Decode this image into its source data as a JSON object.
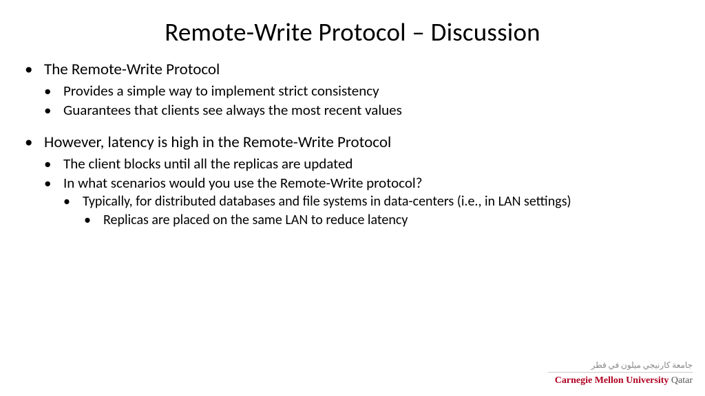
{
  "title": "Remote-Write Protocol – Discussion",
  "bullets": {
    "b1": "The Remote-Write Protocol",
    "b1a": "Provides a simple way to implement strict consistency",
    "b1b": "Guarantees that clients see always the most recent values",
    "b2": "However, latency is high in the Remote-Write Protocol",
    "b2a": "The client blocks until all the replicas are updated",
    "b2b": "In what scenarios would you use the Remote-Write protocol?",
    "b2b1": "Typically, for distributed databases and file systems in data-centers (i.e., in LAN settings)",
    "b2b1a": "Replicas are placed on the same LAN to reduce latency"
  },
  "footer": {
    "arabic": "جامعة كارنيجي ميلون في قطر",
    "org": "Carnegie Mellon University",
    "loc": " Qatar"
  }
}
